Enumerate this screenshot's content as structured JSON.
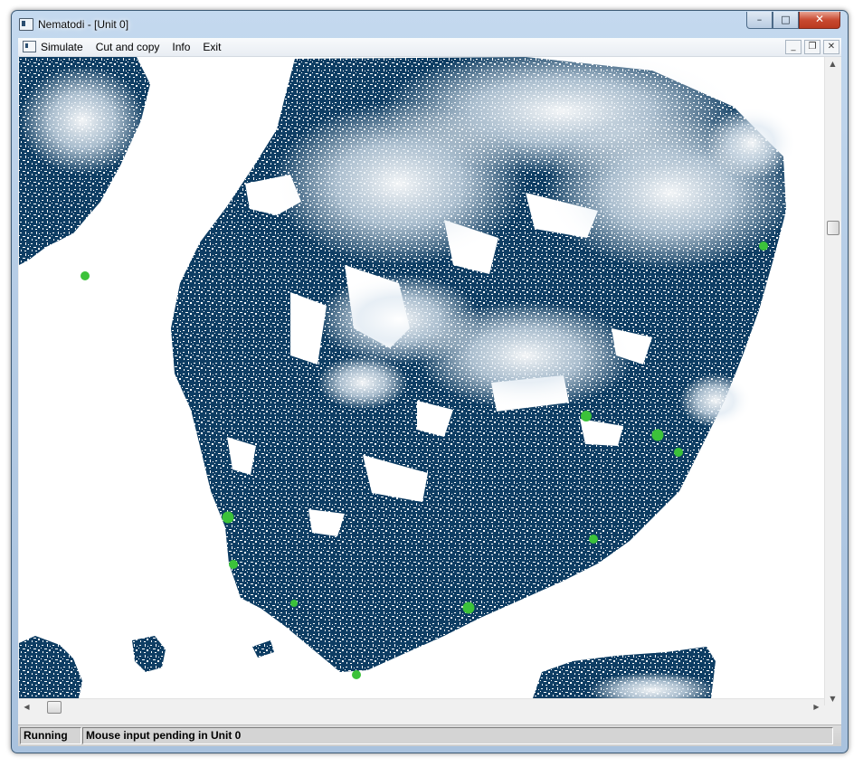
{
  "window": {
    "title": "Nematodi - [Unit 0]"
  },
  "caption_buttons": {
    "minimize": "–",
    "maximize": "□",
    "close": "✕"
  },
  "menu": {
    "items": [
      "Simulate",
      "Cut and copy",
      "Info",
      "Exit"
    ]
  },
  "mdi_buttons": {
    "minimize": "_",
    "restore": "❐",
    "close": "✕"
  },
  "map": {
    "land_color": "#0e3d63",
    "snow_color": "#dfe9f2",
    "marker_color": "#3cc23a",
    "marker_count": 12
  },
  "scrollbars": {
    "up": "▲",
    "down": "▼",
    "left": "◀",
    "right": "▶"
  },
  "status": {
    "state": "Running",
    "message": "Mouse input pending in Unit 0"
  }
}
